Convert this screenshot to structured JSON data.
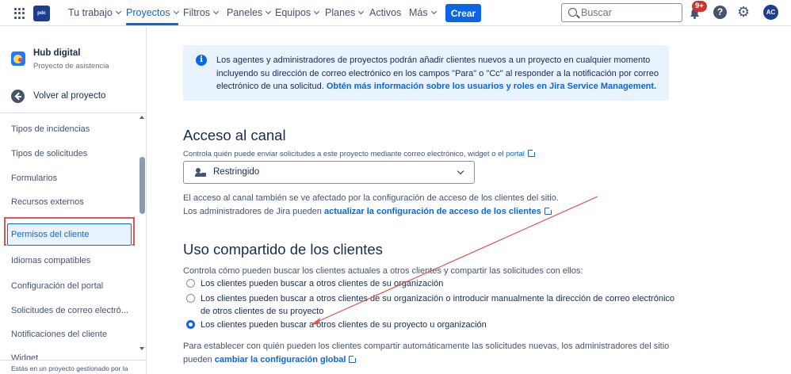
{
  "topnav": {
    "logo_text": "pdc",
    "items": [
      {
        "label": "Tu trabajo",
        "chevron": true
      },
      {
        "label": "Proyectos",
        "chevron": true,
        "active": true
      },
      {
        "label": "Filtros",
        "chevron": true
      },
      {
        "label": "Paneles",
        "chevron": true
      },
      {
        "label": "Equipos",
        "chevron": true
      },
      {
        "label": "Planes",
        "chevron": true
      },
      {
        "label": "Activos",
        "chevron": false
      },
      {
        "label": "Más",
        "chevron": true
      }
    ],
    "create_label": "Crear",
    "search_placeholder": "Buscar",
    "notifications_badge": "9+",
    "help_glyph": "?",
    "settings_glyph": "⚙",
    "avatar_initials": "AC"
  },
  "sidebar": {
    "project_name": "Hub digital",
    "project_type": "Proyecto de asistencia",
    "back_label": "Volver al proyecto",
    "items": [
      {
        "label": "Tipos de incidencias"
      },
      {
        "label": "Tipos de solicitudes"
      },
      {
        "label": "Formularios"
      },
      {
        "label": "Recursos externos"
      },
      {
        "label": "Permisos del cliente",
        "selected": true
      },
      {
        "label": "Idiomas compatibles"
      },
      {
        "label": "Configuración del portal"
      },
      {
        "label": "Solicitudes de correo electró..."
      },
      {
        "label": "Notificaciones del cliente"
      },
      {
        "label": "Widget"
      }
    ],
    "footer_text": "Estás en un proyecto gestionado por la"
  },
  "info_box": {
    "text": "Los agentes y administradores de proyectos podrán añadir clientes nuevos a un proyecto en cualquier momento incluyendo su dirección de correo electrónico en los campos \"Para\" o \"Cc\" al responder a la notificación por correo electrónico de una solicitud. ",
    "link": "Obtén más información sobre los usuarios y roles en Jira Service Management."
  },
  "channel_access": {
    "heading": "Acceso al canal",
    "description": "Controla quién puede enviar solicitudes a este proyecto mediante correo electrónico, widget o el ",
    "description_link": "portal",
    "selected_value": "Restringido",
    "note_line1": "El acceso al canal también se ve afectado por la configuración de acceso de los clientes del sitio.",
    "note_line2": "Los administradores de Jira pueden ",
    "note_link": "actualizar la configuración de acceso de los clientes"
  },
  "customer_sharing": {
    "heading": "Uso compartido de los clientes",
    "description": "Controla cómo pueden buscar los clientes actuales a otros clientes y compartir las solicitudes con ellos:",
    "options": [
      {
        "label": "Los clientes pueden buscar a otros clientes de su organización",
        "checked": false
      },
      {
        "label": "Los clientes pueden buscar a otros clientes de su organización o introducir manualmente la dirección de correo electrónico",
        "label2": "de otros clientes de su proyecto",
        "checked": false
      },
      {
        "label": "Los clientes pueden buscar a otros clientes de su proyecto u organización",
        "checked": true
      }
    ],
    "note_line1": "Para establecer con quién pueden los clientes compartir automáticamente las solicitudes nuevas, los administradores del sitio",
    "note_line2": "pueden ",
    "note_link": "cambiar la configuración global"
  },
  "colors": {
    "accent": "#0c66e4",
    "annotation": "#e05353",
    "info_bg": "#e9f2ff"
  }
}
